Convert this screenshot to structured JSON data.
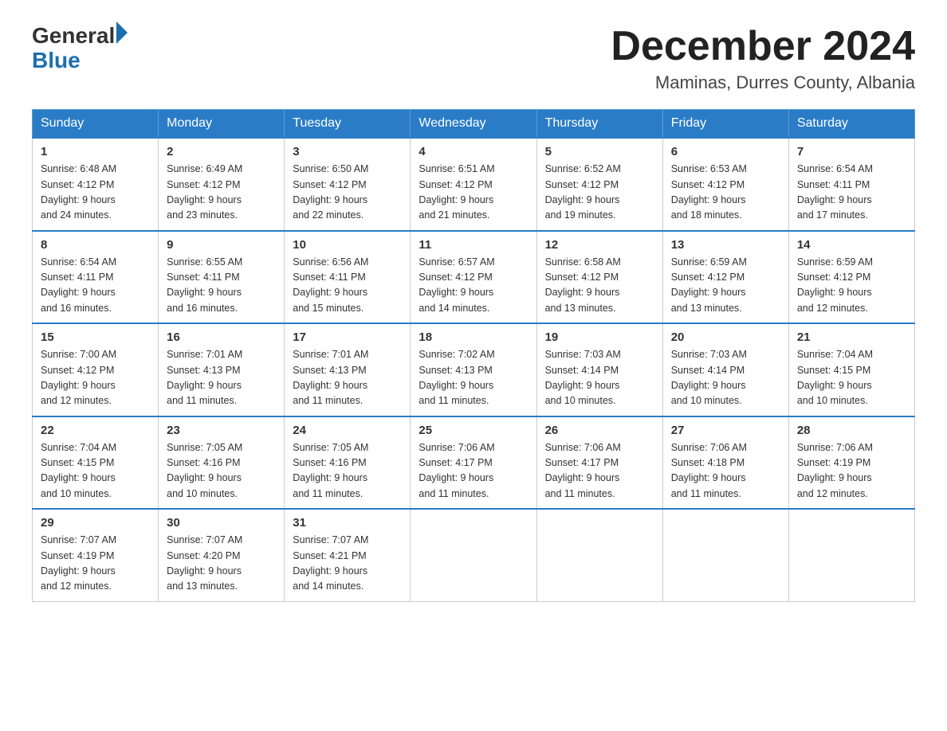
{
  "header": {
    "logo": {
      "general": "General",
      "blue": "Blue",
      "arrow": "▶"
    },
    "title": "December 2024",
    "location": "Maminas, Durres County, Albania"
  },
  "weekdays": [
    "Sunday",
    "Monday",
    "Tuesday",
    "Wednesday",
    "Thursday",
    "Friday",
    "Saturday"
  ],
  "weeks": [
    [
      {
        "day": "1",
        "sunrise": "6:48 AM",
        "sunset": "4:12 PM",
        "daylight": "9 hours and 24 minutes."
      },
      {
        "day": "2",
        "sunrise": "6:49 AM",
        "sunset": "4:12 PM",
        "daylight": "9 hours and 23 minutes."
      },
      {
        "day": "3",
        "sunrise": "6:50 AM",
        "sunset": "4:12 PM",
        "daylight": "9 hours and 22 minutes."
      },
      {
        "day": "4",
        "sunrise": "6:51 AM",
        "sunset": "4:12 PM",
        "daylight": "9 hours and 21 minutes."
      },
      {
        "day": "5",
        "sunrise": "6:52 AM",
        "sunset": "4:12 PM",
        "daylight": "9 hours and 19 minutes."
      },
      {
        "day": "6",
        "sunrise": "6:53 AM",
        "sunset": "4:12 PM",
        "daylight": "9 hours and 18 minutes."
      },
      {
        "day": "7",
        "sunrise": "6:54 AM",
        "sunset": "4:11 PM",
        "daylight": "9 hours and 17 minutes."
      }
    ],
    [
      {
        "day": "8",
        "sunrise": "6:54 AM",
        "sunset": "4:11 PM",
        "daylight": "9 hours and 16 minutes."
      },
      {
        "day": "9",
        "sunrise": "6:55 AM",
        "sunset": "4:11 PM",
        "daylight": "9 hours and 16 minutes."
      },
      {
        "day": "10",
        "sunrise": "6:56 AM",
        "sunset": "4:11 PM",
        "daylight": "9 hours and 15 minutes."
      },
      {
        "day": "11",
        "sunrise": "6:57 AM",
        "sunset": "4:12 PM",
        "daylight": "9 hours and 14 minutes."
      },
      {
        "day": "12",
        "sunrise": "6:58 AM",
        "sunset": "4:12 PM",
        "daylight": "9 hours and 13 minutes."
      },
      {
        "day": "13",
        "sunrise": "6:59 AM",
        "sunset": "4:12 PM",
        "daylight": "9 hours and 13 minutes."
      },
      {
        "day": "14",
        "sunrise": "6:59 AM",
        "sunset": "4:12 PM",
        "daylight": "9 hours and 12 minutes."
      }
    ],
    [
      {
        "day": "15",
        "sunrise": "7:00 AM",
        "sunset": "4:12 PM",
        "daylight": "9 hours and 12 minutes."
      },
      {
        "day": "16",
        "sunrise": "7:01 AM",
        "sunset": "4:13 PM",
        "daylight": "9 hours and 11 minutes."
      },
      {
        "day": "17",
        "sunrise": "7:01 AM",
        "sunset": "4:13 PM",
        "daylight": "9 hours and 11 minutes."
      },
      {
        "day": "18",
        "sunrise": "7:02 AM",
        "sunset": "4:13 PM",
        "daylight": "9 hours and 11 minutes."
      },
      {
        "day": "19",
        "sunrise": "7:03 AM",
        "sunset": "4:14 PM",
        "daylight": "9 hours and 10 minutes."
      },
      {
        "day": "20",
        "sunrise": "7:03 AM",
        "sunset": "4:14 PM",
        "daylight": "9 hours and 10 minutes."
      },
      {
        "day": "21",
        "sunrise": "7:04 AM",
        "sunset": "4:15 PM",
        "daylight": "9 hours and 10 minutes."
      }
    ],
    [
      {
        "day": "22",
        "sunrise": "7:04 AM",
        "sunset": "4:15 PM",
        "daylight": "9 hours and 10 minutes."
      },
      {
        "day": "23",
        "sunrise": "7:05 AM",
        "sunset": "4:16 PM",
        "daylight": "9 hours and 10 minutes."
      },
      {
        "day": "24",
        "sunrise": "7:05 AM",
        "sunset": "4:16 PM",
        "daylight": "9 hours and 11 minutes."
      },
      {
        "day": "25",
        "sunrise": "7:06 AM",
        "sunset": "4:17 PM",
        "daylight": "9 hours and 11 minutes."
      },
      {
        "day": "26",
        "sunrise": "7:06 AM",
        "sunset": "4:17 PM",
        "daylight": "9 hours and 11 minutes."
      },
      {
        "day": "27",
        "sunrise": "7:06 AM",
        "sunset": "4:18 PM",
        "daylight": "9 hours and 11 minutes."
      },
      {
        "day": "28",
        "sunrise": "7:06 AM",
        "sunset": "4:19 PM",
        "daylight": "9 hours and 12 minutes."
      }
    ],
    [
      {
        "day": "29",
        "sunrise": "7:07 AM",
        "sunset": "4:19 PM",
        "daylight": "9 hours and 12 minutes."
      },
      {
        "day": "30",
        "sunrise": "7:07 AM",
        "sunset": "4:20 PM",
        "daylight": "9 hours and 13 minutes."
      },
      {
        "day": "31",
        "sunrise": "7:07 AM",
        "sunset": "4:21 PM",
        "daylight": "9 hours and 14 minutes."
      },
      null,
      null,
      null,
      null
    ]
  ]
}
